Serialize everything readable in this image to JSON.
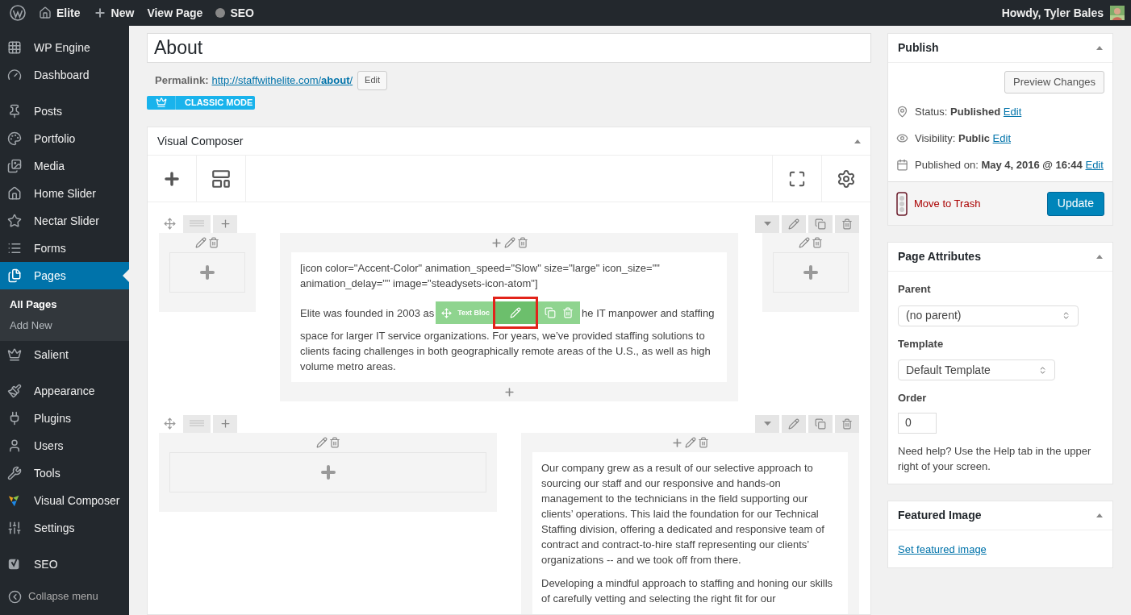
{
  "topbar": {
    "items": [
      {
        "kind": "logo"
      },
      {
        "kind": "home",
        "label": "Elite"
      },
      {
        "kind": "new",
        "label": "New"
      },
      {
        "kind": "plain",
        "label": "View Page"
      },
      {
        "kind": "seo",
        "label": "SEO"
      }
    ],
    "greeting": "Howdy, Tyler Bales"
  },
  "sidebar": {
    "sections": [
      [
        {
          "label": "WP Engine",
          "selected": false
        },
        {
          "label": "Dashboard",
          "selected": false
        }
      ],
      [
        {
          "label": "Posts",
          "selected": false
        },
        {
          "label": "Portfolio",
          "selected": false
        },
        {
          "label": "Media",
          "selected": false
        },
        {
          "label": "Home Slider",
          "selected": false
        },
        {
          "label": "Nectar Slider",
          "selected": false
        },
        {
          "label": "Forms",
          "selected": false
        },
        {
          "label": "Pages",
          "selected": true,
          "children": [
            {
              "label": "All Pages",
              "selected": true
            },
            {
              "label": "Add New",
              "selected": false
            }
          ]
        },
        {
          "label": "Salient",
          "selected": false
        }
      ],
      [
        {
          "label": "Appearance",
          "selected": false
        },
        {
          "label": "Plugins",
          "selected": false
        },
        {
          "label": "Users",
          "selected": false
        },
        {
          "label": "Tools",
          "selected": false
        },
        {
          "label": "Visual Composer",
          "selected": false
        },
        {
          "label": "Settings",
          "selected": false
        }
      ],
      [
        {
          "label": "SEO",
          "selected": false
        }
      ]
    ],
    "collapse": "Collapse menu"
  },
  "editor": {
    "title": "About",
    "permalink": {
      "label": "Permalink:",
      "url": "http://staffwithelite.com/**about**/",
      "edit": "Edit"
    },
    "classic_mode": "CLASSIC MODE"
  },
  "composer": {
    "title": "Visual Composer",
    "rows": [
      {
        "columns": [
          {
            "kind": "empty"
          },
          {
            "kind": "text",
            "paragraphs": [
              {
                "kind": "plain",
                "text": "[icon color=\"Accent-Color\" animation_speed=\"Slow\" size=\"large\" icon_size=\"\" animation_delay=\"\" image=\"steadysets-icon-atom\"]"
              },
              {
                "kind": "overlaid",
                "before": "Elite was founded in 2003 as",
                "toolbar_label": "Text Bloc",
                "after": "he IT manpower and staffing",
                "rest": "space for larger IT service organizations. For years, we’ve provided staffing solutions to clients facing challenges in both geographically remote areas of the U.S., as well as high volume metro areas."
              }
            ]
          },
          {
            "kind": "empty"
          }
        ]
      },
      {
        "columns": [
          {
            "kind": "empty"
          },
          {
            "kind": "text",
            "paragraphs": [
              {
                "kind": "plain",
                "text": "Our company grew as a result of our selective approach to sourcing our staff and our responsive and hands-on management to the technicians in the field supporting our clients’ operations. This laid the foundation for our Technical Staffing division, offering a dedicated and responsive team of contract and contract-to-hire staff representing our clients’ organizations -- and we took off from there."
              },
              {
                "kind": "plain",
                "text": "Developing a mindful approach to staffing and honing our skills of carefully vetting and selecting the right fit for our"
              }
            ]
          }
        ]
      }
    ]
  },
  "publish": {
    "title": "Publish",
    "preview": "Preview Changes",
    "rows": [
      {
        "label": "Status:",
        "value": "Published",
        "edit": "Edit"
      },
      {
        "label": "Visibility:",
        "value": "Public",
        "edit": "Edit"
      },
      {
        "label": "Published on:",
        "value": "May 4, 2016 @ 16:44",
        "edit": "Edit"
      }
    ],
    "trash": "Move to Trash",
    "update": "Update"
  },
  "page_attributes": {
    "title": "Page Attributes",
    "parent_label": "Parent",
    "parent": "(no parent)",
    "template_label": "Template",
    "template": "Default Template",
    "order_label": "Order",
    "order": "0",
    "help": "Need help? Use the Help tab in the upper right of your screen."
  },
  "featured_image": {
    "title": "Featured Image",
    "link": "Set featured image"
  }
}
